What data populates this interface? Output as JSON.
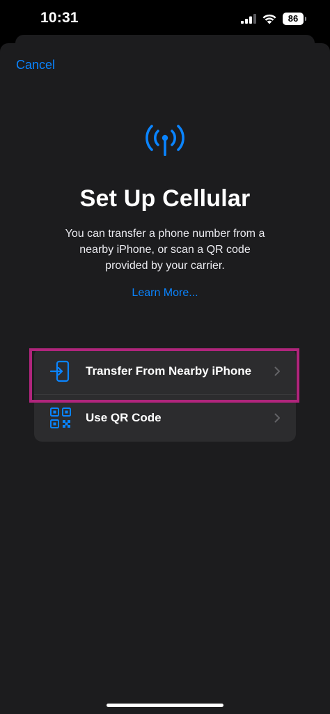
{
  "status_bar": {
    "time": "10:31",
    "battery_level": "86",
    "cellular_bars": 3,
    "icons": [
      "signal-bars-icon",
      "wifi-icon",
      "battery-icon"
    ]
  },
  "sheet": {
    "cancel_label": "Cancel",
    "hero_icon": "cellular-antenna-icon",
    "title": "Set Up Cellular",
    "subtitle": "You can transfer a phone number from a nearby iPhone, or scan a QR code provided by your carrier.",
    "learn_more_label": "Learn More..."
  },
  "options": [
    {
      "label": "Transfer From Nearby iPhone",
      "icon": "transfer-phone-icon"
    },
    {
      "label": "Use QR Code",
      "icon": "qr-code-icon"
    }
  ],
  "highlight": {
    "target": "Use QR Code",
    "color": "#b0257c"
  },
  "colors": {
    "accent": "#0a84ff",
    "sheet_bg": "#1c1c1e",
    "group_bg": "#2c2c2e"
  }
}
